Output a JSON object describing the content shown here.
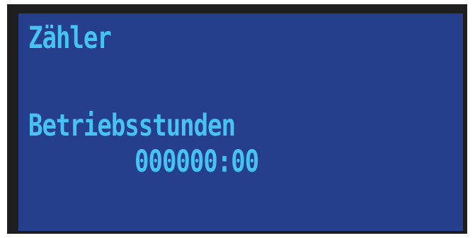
{
  "display": {
    "title": "Zähler",
    "counter_label": "Betriebsstunden",
    "counter_value": "000000:00"
  },
  "colors": {
    "bezel": "#1e1e1e",
    "screen_background": "#263f8c",
    "text": "#46c3f2"
  }
}
